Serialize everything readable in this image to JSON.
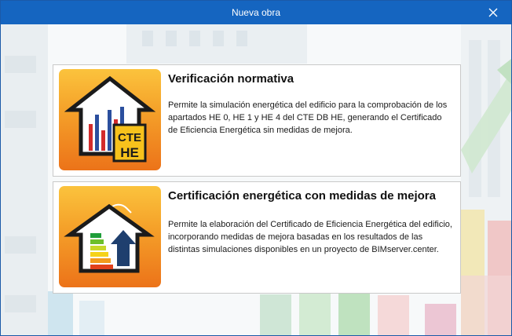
{
  "window": {
    "title": "Nueva obra"
  },
  "options": [
    {
      "title": "Verificación normativa",
      "description": "Permite la simulación energética del edificio para la comprobación de los apartados HE 0, HE 1 y HE 4 del CTE DB HE, generando el Certificado de Eficiencia Energética sin medidas de mejora.",
      "icon": "house-chart-cte-he-icon",
      "badge_line1": "CTE",
      "badge_line2": "HE"
    },
    {
      "title": "Certificación energética con medidas de mejora",
      "description": "Permite la elaboración del Certificado de Eficiencia Energética del edificio, incorporando medidas de mejora basadas en los resultados de las distintas simulaciones disponibles en un proyecto de BIMserver.center.",
      "icon": "house-energy-label-arrow-icon"
    }
  ],
  "colors": {
    "titlebar": "#1565c0",
    "tile_top": "#fbc33d",
    "tile_bottom": "#ec7319",
    "badge": "#f7c21c"
  }
}
